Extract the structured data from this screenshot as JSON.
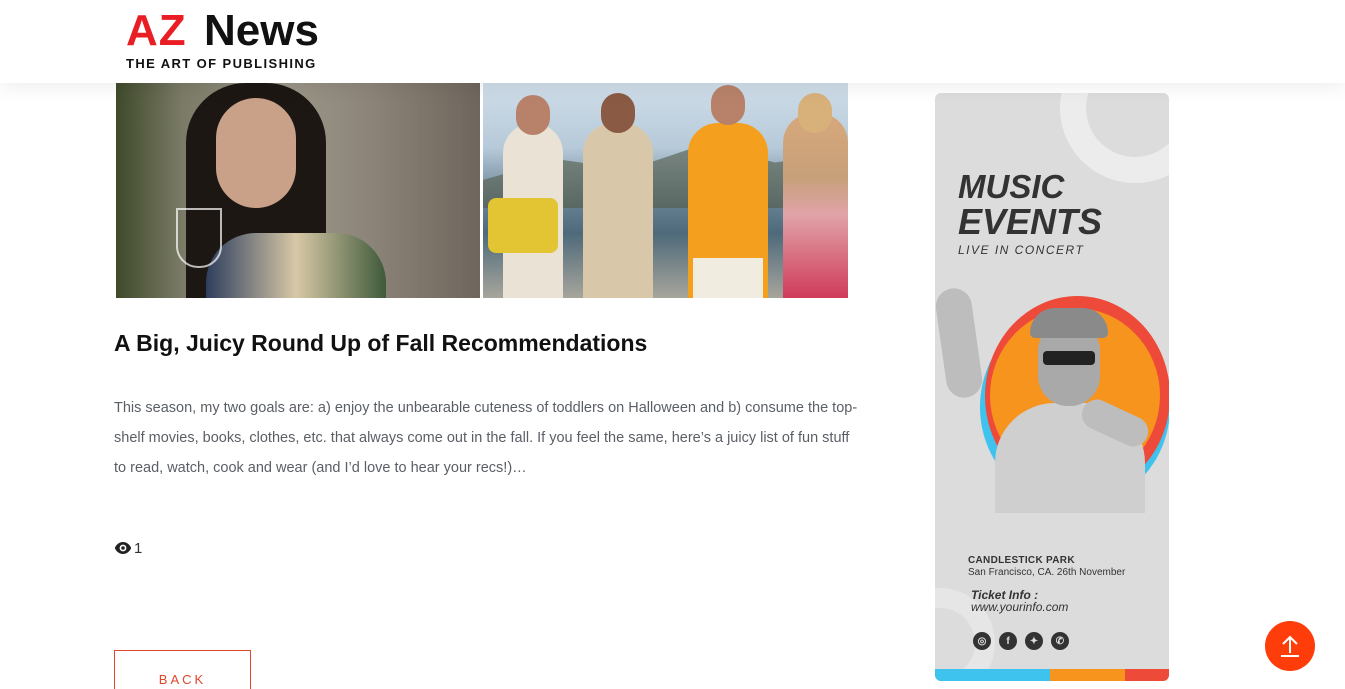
{
  "header": {
    "logo_brand": "AZ",
    "logo_name": "News",
    "tagline": "THE ART OF PUBLISHING"
  },
  "article": {
    "title": "A Big, Juicy Round Up of Fall Recommendations",
    "excerpt": "This season, my two goals are: a) enjoy the unbearable cuteness of toddlers on Halloween and b) consume the top-shelf movies, books, clothes, etc. that always come out in the fall. If you feel the same, here’s a juicy list of fun stuff to read, watch, cook and wear (and I’d love to hear your recs!)…",
    "views": "1",
    "back_label": "BACK"
  },
  "ad": {
    "title_line1": "MUSIC",
    "title_line2": "EVENTS",
    "subtitle": "LIVE IN CONCERT",
    "venue": "CANDLESTICK PARK",
    "location": "San Francisco, CA. 26th November",
    "ticket_label": "Ticket Info :",
    "url": "www.yourinfo.com",
    "socials": [
      "instagram-icon",
      "facebook-icon",
      "twitter-icon",
      "whatsapp-icon"
    ]
  },
  "colors": {
    "brand_red": "#e91e24",
    "accent": "#e0462a",
    "scroll_top": "#ff3d0b"
  },
  "icons": {
    "views": "eye-icon",
    "scroll_top": "arrow-up-icon"
  }
}
